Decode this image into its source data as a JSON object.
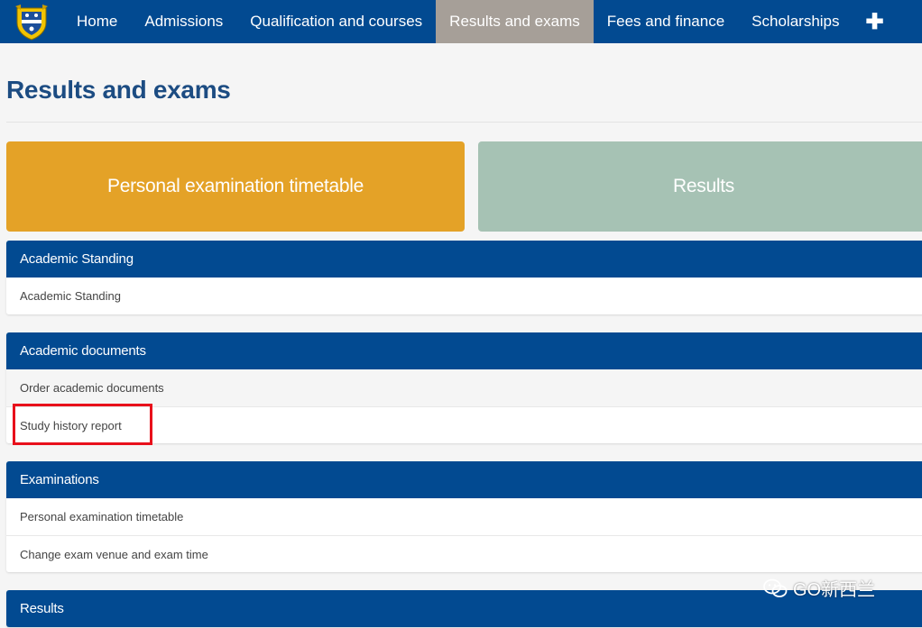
{
  "nav": {
    "items": [
      {
        "label": "Home"
      },
      {
        "label": "Admissions"
      },
      {
        "label": "Qualification and courses"
      },
      {
        "label": "Results and exams"
      },
      {
        "label": "Fees and finance"
      },
      {
        "label": "Scholarships"
      }
    ],
    "more_label": "✚"
  },
  "page": {
    "title": "Results and exams"
  },
  "tiles": [
    {
      "label": "Personal examination timetable",
      "color": "#e4a227"
    },
    {
      "label": "Results",
      "color": "#a6c2b4"
    }
  ],
  "panels": [
    {
      "heading": "Academic Standing",
      "rows": [
        "Academic Standing"
      ]
    },
    {
      "heading": "Academic documents",
      "rows": [
        "Order academic documents",
        "Study history report"
      ]
    },
    {
      "heading": "Examinations",
      "rows": [
        "Personal examination timetable",
        "Change exam venue and exam time"
      ]
    },
    {
      "heading": "Results",
      "rows": []
    }
  ],
  "watermark": {
    "text": "GO新西兰"
  },
  "colors": {
    "nav_bg": "#024a91",
    "nav_active": "#a69f98",
    "title": "#1c4c82",
    "highlight": "#e8101b"
  }
}
